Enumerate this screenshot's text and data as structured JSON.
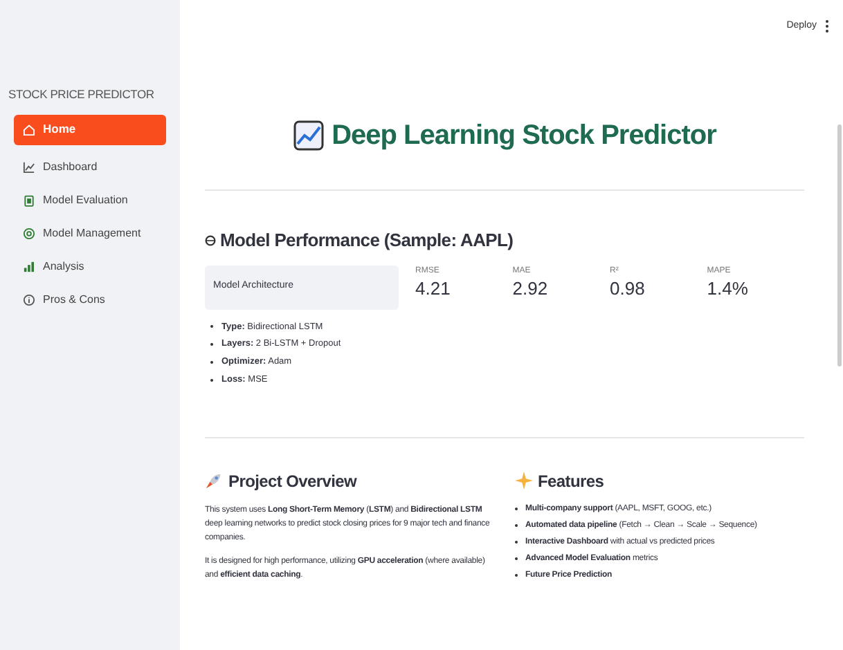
{
  "header": {
    "deploy": "Deploy"
  },
  "sidebar": {
    "title": "STOCK PRICE PREDICTOR",
    "items": [
      {
        "label": "Home",
        "selected": true
      },
      {
        "label": "Dashboard",
        "selected": false
      },
      {
        "label": "Model Evaluation",
        "selected": false
      },
      {
        "label": "Model Management",
        "selected": false
      },
      {
        "label": "Analysis",
        "selected": false
      },
      {
        "label": "Pros & Cons",
        "selected": false
      }
    ]
  },
  "title": "Deep Learning Stock Predictor",
  "performance": {
    "heading": "Model Performance (Sample: AAPL)",
    "architecture_label": "Model Architecture",
    "metrics": [
      {
        "label": "RMSE",
        "value": "4.21"
      },
      {
        "label": "MAE",
        "value": "2.92"
      },
      {
        "label": "R²",
        "value": "0.98"
      },
      {
        "label": "MAPE",
        "value": "1.4%"
      }
    ],
    "details": [
      "**Type:** Bidirectional LSTM",
      "**Layers:** 2 Bi-LSTM + Dropout",
      "**Optimizer:** Adam",
      "**Loss:** MSE"
    ]
  },
  "overview": {
    "heading": "Project Overview",
    "paragraphs": [
      "This system uses **Long Short-Term Memory** (**LSTM**) and **Bidirectional LSTM** deep learning networks to predict stock closing prices for 9 major tech and finance companies.",
      "It is designed for high performance, utilizing **GPU acceleration** (where available) and **efficient data caching**."
    ]
  },
  "features": {
    "heading": "Features",
    "items": [
      "**Multi-company support** (AAPL, MSFT, GOOG, etc.)",
      "**Automated data pipeline** (Fetch → Clean → Scale → Sequence)",
      "**Interactive Dashboard** with actual vs predicted prices",
      "**Advanced Model Evaluation** metrics",
      "**Future Price Prediction**"
    ]
  }
}
